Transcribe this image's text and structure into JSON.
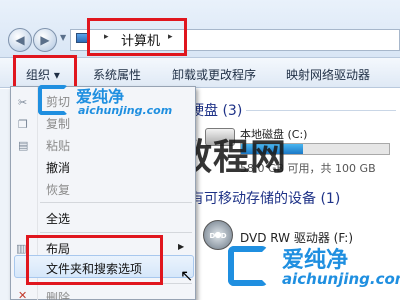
{
  "address_bar": {
    "crumb_arrow": "▸",
    "current_location": "计算机",
    "location_icon": "computer-icon"
  },
  "toolbar": {
    "organize_label": "组织 ▾",
    "items": [
      "系统属性",
      "卸载或更改程序",
      "映射网络驱动器"
    ]
  },
  "content": {
    "hdd_group_title": "硬盘 (3)",
    "drive_c_label": "本地磁盘 (C:)",
    "drive_c_free_text": "58.0 GB 可用，共 100 GB",
    "drive_c_used_fraction": 0.42,
    "removable_group_title": "有可移动存储的设备 (1)",
    "dvd_label": "DVD RW 驱动器 (F:)",
    "dvd_icon_text": "DVD"
  },
  "menu": {
    "items": {
      "cut": "剪切",
      "copy": "复制",
      "paste": "粘贴",
      "undo": "撤消",
      "redo": "恢复",
      "select_all": "全选",
      "layout": "布局",
      "folder_options": "文件夹和搜索选项",
      "delete": "删除"
    }
  },
  "watermarks": {
    "big_text": "木星教程网",
    "logo_cn": "爱纯净",
    "logo_en": "aichunjing.com"
  },
  "colors": {
    "highlight_box": "#e0161e",
    "logo_blue": "#1f8fe0",
    "group_title": "#1e3287"
  }
}
